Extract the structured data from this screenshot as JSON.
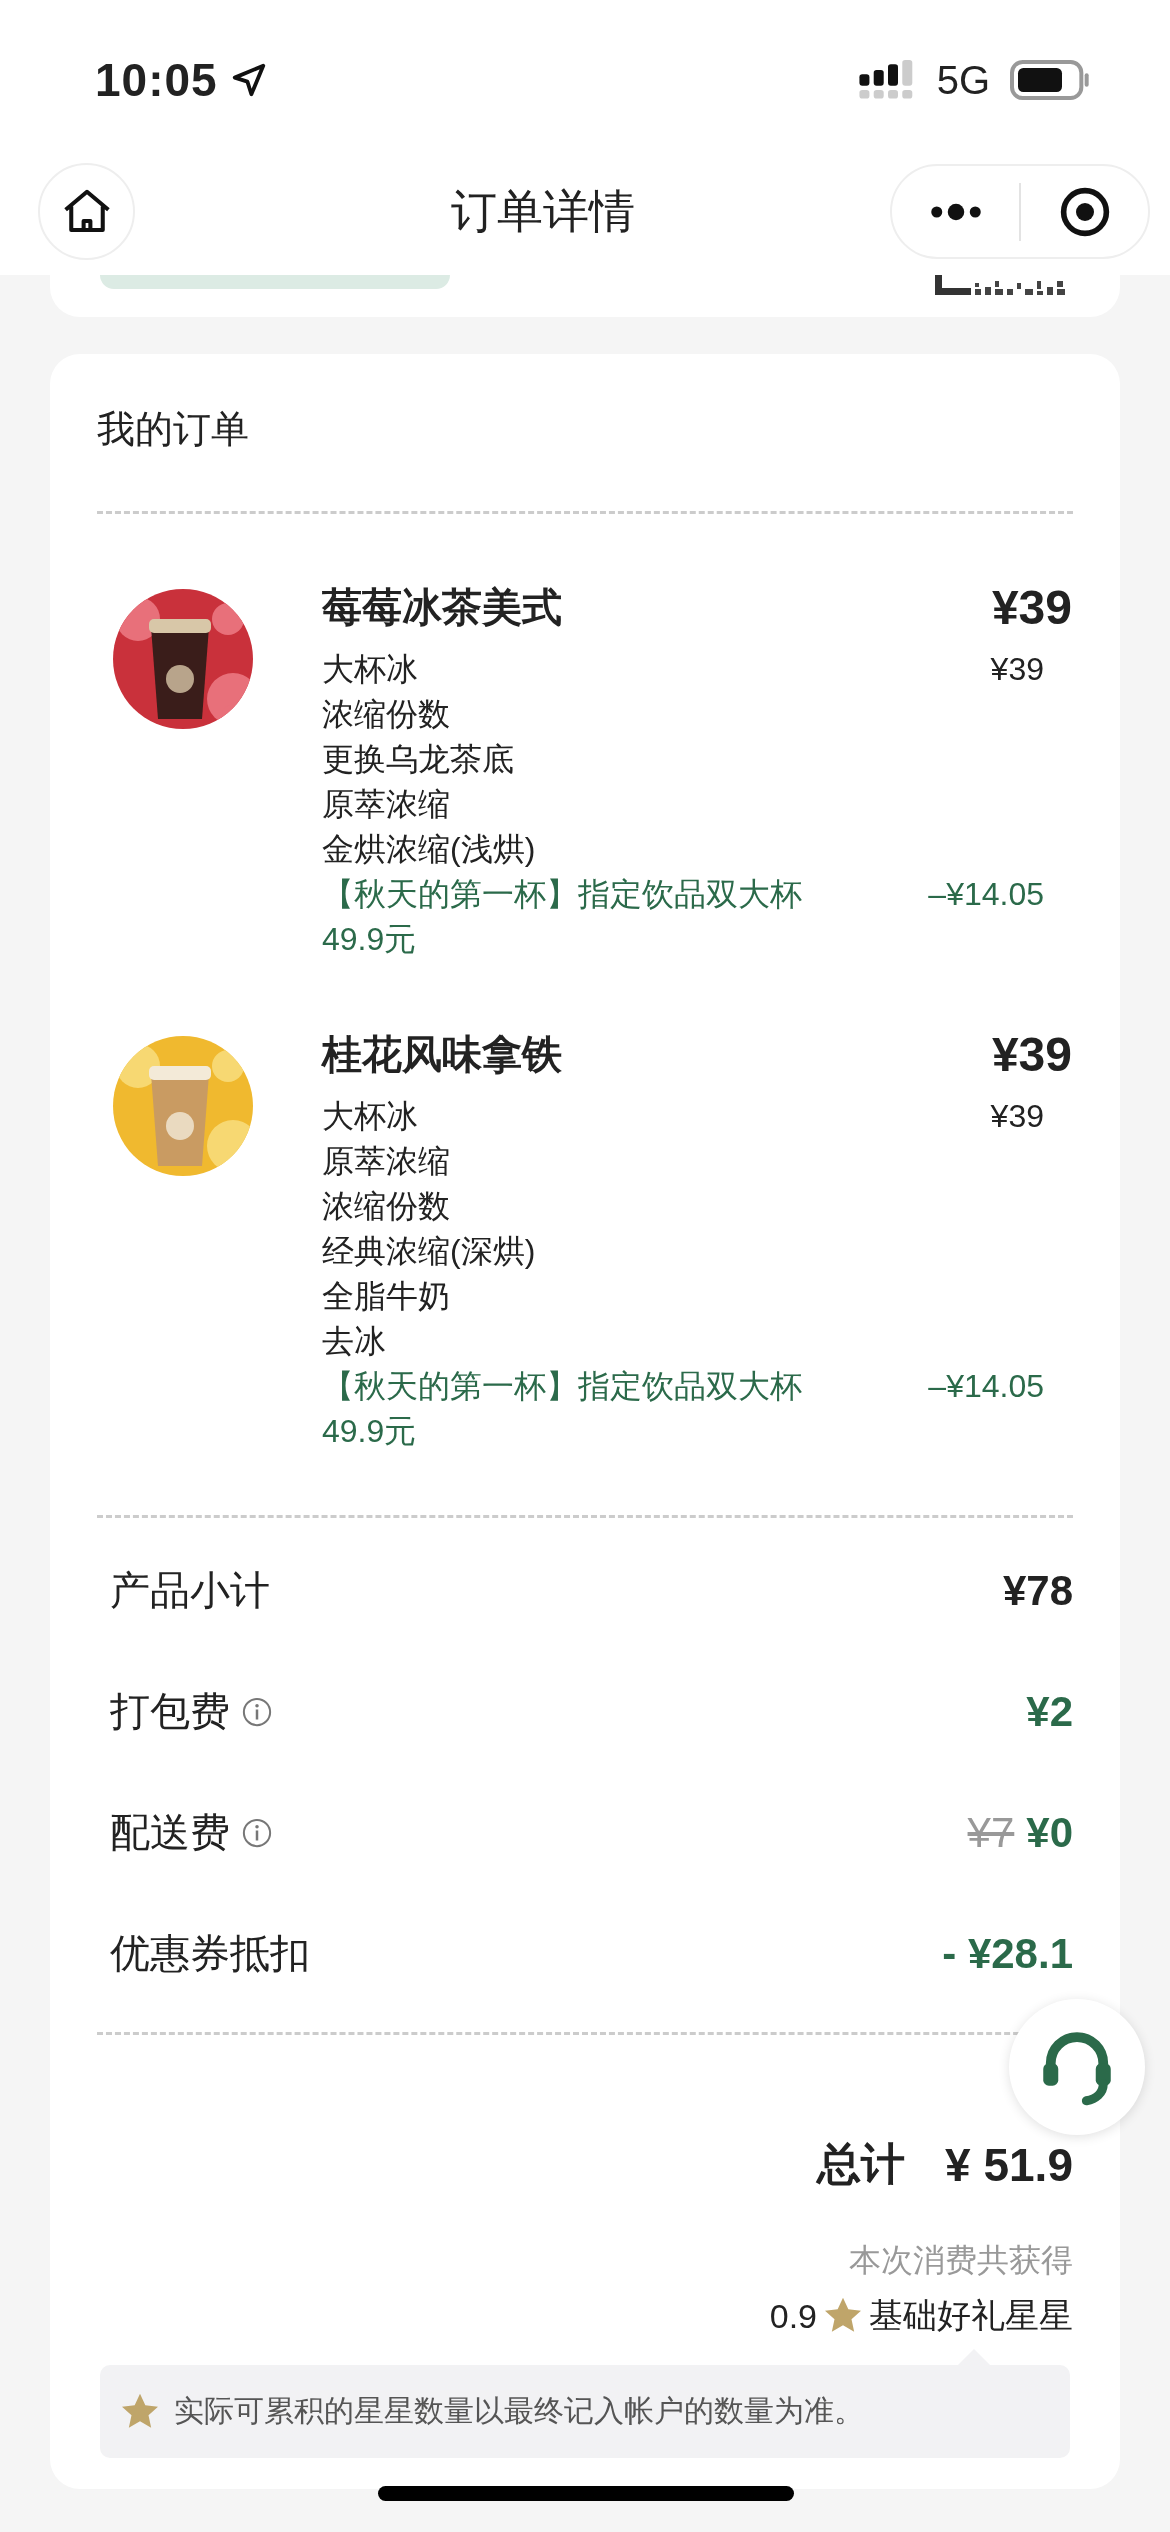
{
  "status_bar": {
    "time": "10:05",
    "network": "5G"
  },
  "nav": {
    "title": "订单详情"
  },
  "order": {
    "title": "我的订单",
    "items": [
      {
        "name": "莓莓冰茶美式",
        "price": "¥39",
        "unit_price": "¥39",
        "options": [
          "大杯冰",
          "浓缩份数",
          "更换乌龙茶底",
          "原萃浓缩",
          "金烘浓缩(浅烘)"
        ],
        "promo": {
          "text": "【秋天的第一杯】指定饮品双大杯49.9元",
          "amount": "–¥14.05"
        }
      },
      {
        "name": "桂花风味拿铁",
        "price": "¥39",
        "unit_price": "¥39",
        "options": [
          "大杯冰",
          "原萃浓缩",
          "浓缩份数",
          "经典浓缩(深烘)",
          "全脂牛奶",
          "去冰"
        ],
        "promo": {
          "text": "【秋天的第一杯】指定饮品双大杯49.9元",
          "amount": "–¥14.05"
        }
      }
    ],
    "summary": [
      {
        "label": "产品小计",
        "info": false,
        "amount": "¥78",
        "color": "#222222"
      },
      {
        "label": "打包费",
        "info": true,
        "amount": "¥2",
        "color": "#2b6a4a"
      },
      {
        "label": "配送费",
        "info": true,
        "original_amount": "¥7",
        "amount": "¥0",
        "color": "#2b6a4a"
      },
      {
        "label": "优惠券抵扣",
        "info": false,
        "amount": "- ¥28.1",
        "color": "#2b6a4a"
      }
    ],
    "total": {
      "label": "总计",
      "amount": "¥ 51.9"
    },
    "stars": {
      "caption": "本次消费共获得",
      "amount": "0.9",
      "unit": "基础好礼星星",
      "note": "实际可累积的星星数量以最终记入帐户的数量为准。"
    }
  }
}
